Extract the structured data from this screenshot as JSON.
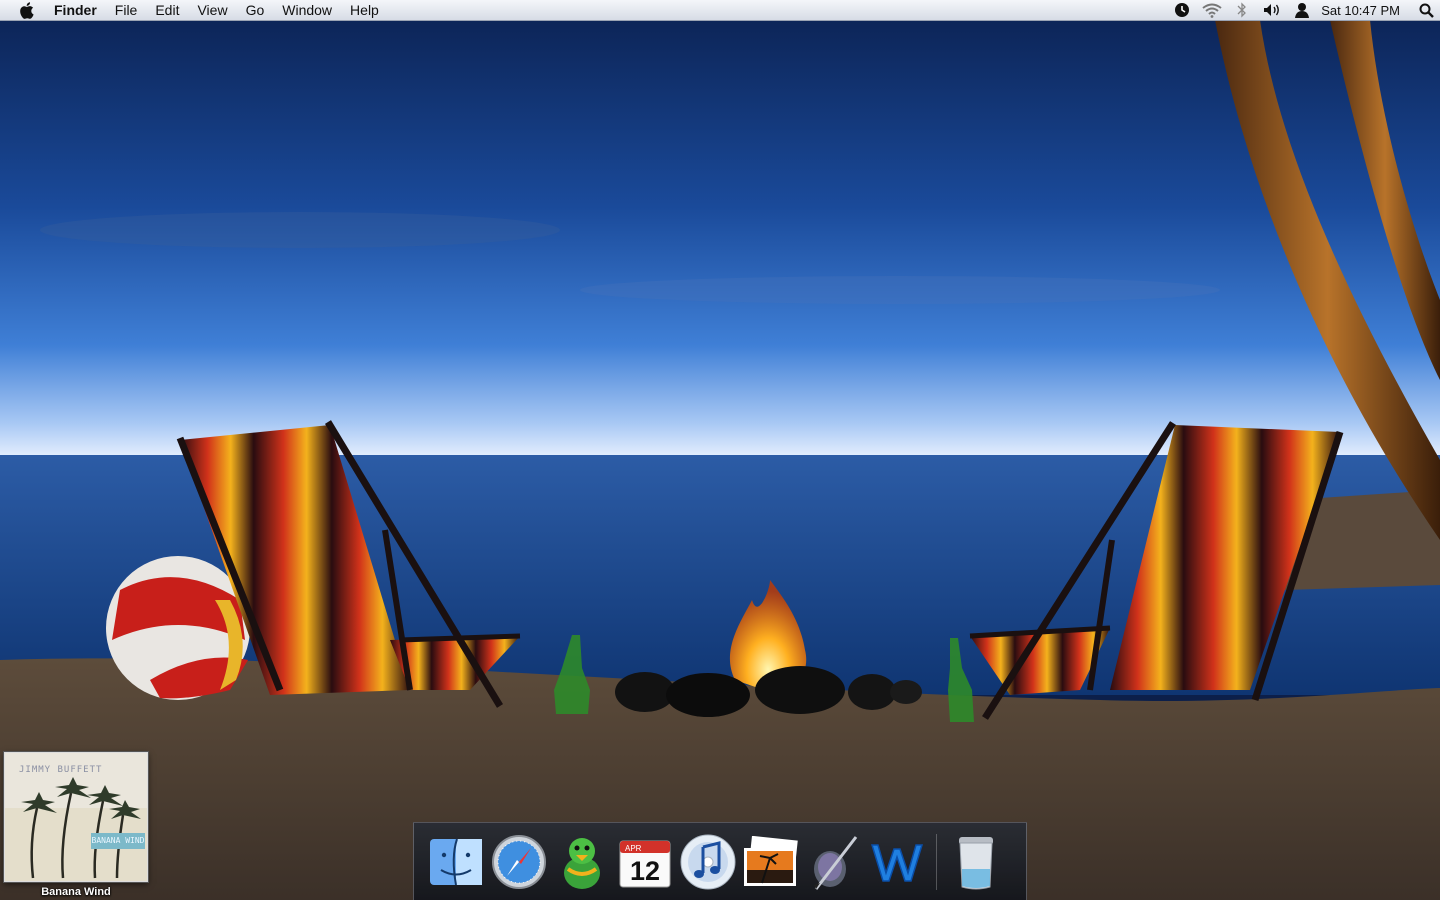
{
  "menubar": {
    "apple_icon": "apple-icon",
    "app_name": "Finder",
    "menus": [
      "File",
      "Edit",
      "View",
      "Go",
      "Window",
      "Help"
    ],
    "status_icons": [
      "time-machine-icon",
      "wifi-icon",
      "bluetooth-icon",
      "volume-icon",
      "user-icon"
    ],
    "clock": "Sat 10:47 PM",
    "spotlight_icon": "spotlight-search-icon"
  },
  "desktop": {
    "items": [
      {
        "label": "Banana Wind",
        "icon": "album-cover-icon",
        "cover_artist_text": "JIMMY BUFFETT",
        "cover_title_text": "BANANA WIND"
      }
    ]
  },
  "dock": {
    "items": [
      {
        "name": "Finder",
        "icon": "finder-icon"
      },
      {
        "name": "Safari",
        "icon": "safari-icon"
      },
      {
        "name": "Adium",
        "icon": "adium-duck-icon"
      },
      {
        "name": "iCal",
        "icon": "ical-icon",
        "month": "APR",
        "day": "12"
      },
      {
        "name": "iTunes",
        "icon": "itunes-icon"
      },
      {
        "name": "iPhoto",
        "icon": "iphoto-icon"
      },
      {
        "name": "Script Editor",
        "icon": "script-editor-icon"
      },
      {
        "name": "Word",
        "icon": "word-icon"
      },
      {
        "name": "Trash",
        "icon": "trash-icon"
      }
    ]
  },
  "colors": {
    "sky_top": "#0d2450",
    "horizon_glow": "#dbe9ff",
    "sea": "#1d4a8e",
    "sand": "#4a3c30"
  }
}
